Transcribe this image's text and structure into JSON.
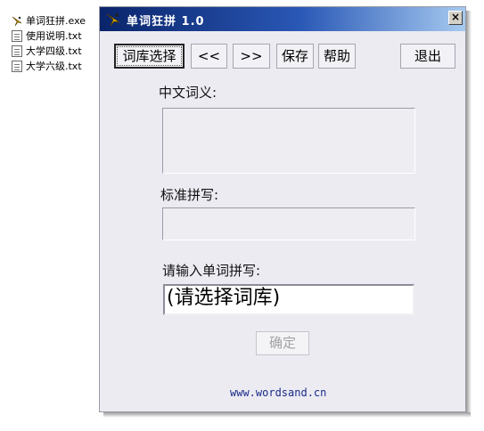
{
  "files": [
    {
      "name": "单词狂拼.exe",
      "icon": "bird-app-icon"
    },
    {
      "name": "使用说明.txt",
      "icon": "text-file-icon"
    },
    {
      "name": "大学四级.txt",
      "icon": "text-file-icon"
    },
    {
      "name": "大学六级.txt",
      "icon": "text-file-icon"
    }
  ],
  "window": {
    "title": "单词狂拼 1.0",
    "close_label": "×"
  },
  "toolbar": {
    "dict_select": "词库选择",
    "prev": "<<",
    "next": ">>",
    "save": "保存",
    "help": "帮助",
    "exit": "退出"
  },
  "form": {
    "meaning_label": "中文词义:",
    "meaning_value": "",
    "standard_label": "标准拼写:",
    "standard_value": "",
    "input_label": "请输入单词拼写:",
    "input_value": "(请选择词库)",
    "confirm": "确定"
  },
  "footer": {
    "url": "www.wordsand.cn"
  },
  "colors": {
    "title_start": "#0a246a",
    "title_end": "#a6caf0",
    "window_bg": "#ecebf2",
    "link": "#1a2a88"
  }
}
